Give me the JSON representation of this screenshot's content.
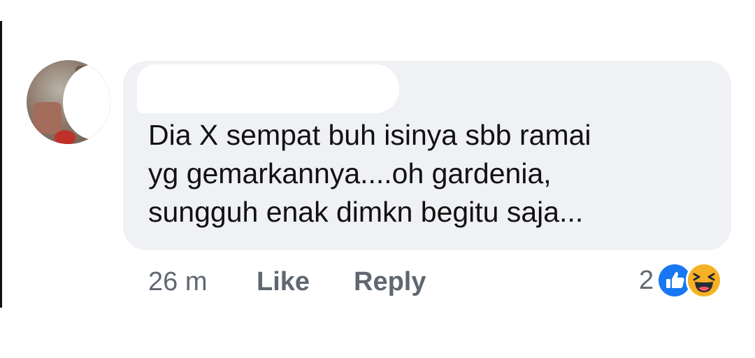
{
  "comment": {
    "text_lines": [
      "Dia X sempat buh isinya sbb ramai",
      "yg gemarkannya....oh gardenia,",
      "sungguh enak dimkn begitu saja..."
    ]
  },
  "actions": {
    "time": "26 m",
    "like_label": "Like",
    "reply_label": "Reply"
  },
  "reactions": {
    "count": "2",
    "icons": [
      "like-icon",
      "haha-icon"
    ],
    "colors": {
      "like": "#1877f2",
      "haha": "#f7b125"
    }
  },
  "theme": {
    "bubble_color": "#eff1f4",
    "text_color": "#111111",
    "meta_color": "#606770"
  }
}
